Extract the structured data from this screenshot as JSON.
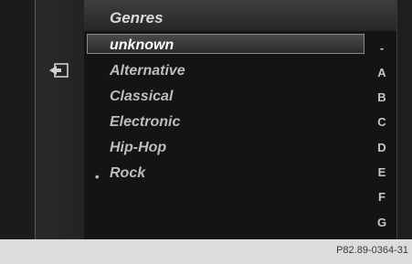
{
  "header": {
    "title": "Genres"
  },
  "list": {
    "items": [
      {
        "label": "unknown",
        "selected": true,
        "bullet": ""
      },
      {
        "label": "Alternative",
        "selected": false,
        "bullet": ""
      },
      {
        "label": "Classical",
        "selected": false,
        "bullet": ""
      },
      {
        "label": "Electronic",
        "selected": false,
        "bullet": ""
      },
      {
        "label": "Hip-Hop",
        "selected": false,
        "bullet": ""
      },
      {
        "label": "Rock",
        "selected": false,
        "bullet": "•"
      }
    ]
  },
  "alphabet": [
    "-",
    "A",
    "B",
    "C",
    "D",
    "E",
    "F",
    "G"
  ],
  "icons": {
    "back": "back-icon"
  },
  "footer": {
    "code": "P82.89-0364-31"
  },
  "colors": {
    "background": "#0f0f0f",
    "panel": "#262626",
    "text": "#bdbdbd",
    "selected_text": "#ffffff",
    "footer_bg": "#dcdcdc"
  }
}
